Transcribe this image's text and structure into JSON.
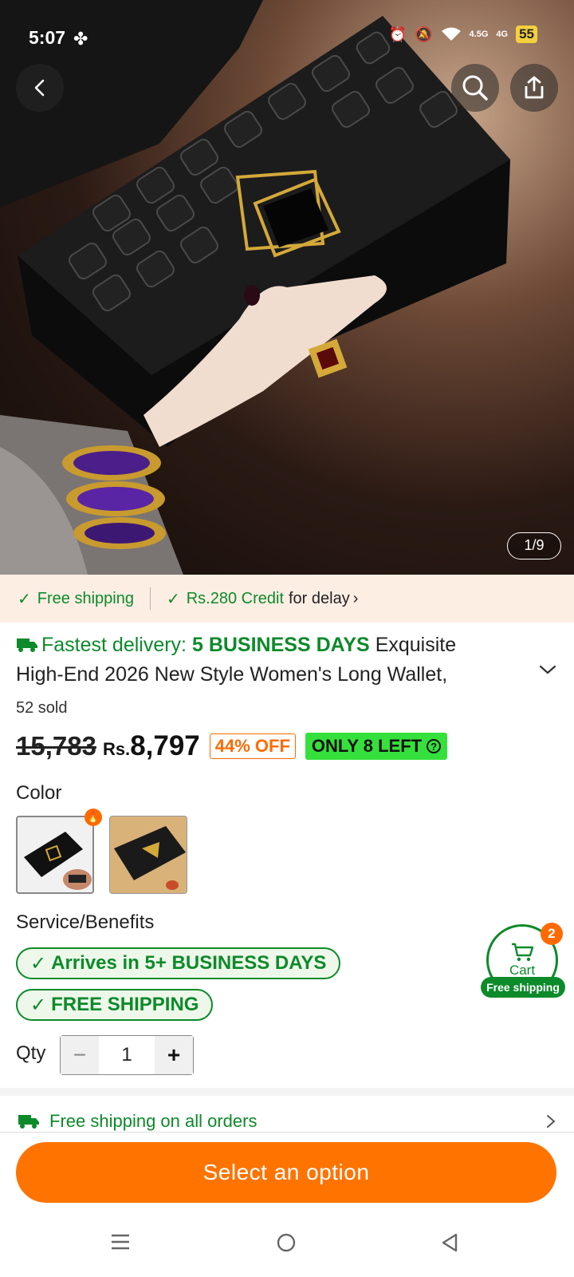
{
  "status_bar": {
    "time": "5:07",
    "battery": "55",
    "net1": "4.5G",
    "net2": "4G"
  },
  "hero": {
    "image_counter": "1/9"
  },
  "benefits_strip": {
    "free_shipping": "Free shipping",
    "credit_amount": "Rs.280 Credit",
    "credit_suffix": "for delay"
  },
  "product": {
    "delivery_prefix": "Fastest delivery:",
    "delivery_days": "5 BUSINESS DAYS",
    "title_line1": "Exquisite",
    "title_line2": "High-End 2026 New Style Women's Long Wallet,",
    "sold": "52 sold",
    "old_price": "15,783",
    "currency": "Rs.",
    "new_price": "8,797",
    "discount": "44% OFF",
    "stock": "ONLY 8 LEFT"
  },
  "color_section": {
    "label": "Color"
  },
  "service": {
    "label": "Service/Benefits",
    "pill1": "Arrives in 5+ BUSINESS DAYS",
    "pill2": "FREE SHIPPING"
  },
  "cart": {
    "label": "Cart",
    "count": "2",
    "free_label": "Free shipping"
  },
  "quantity": {
    "label": "Qty",
    "value": "1"
  },
  "shipping_row": {
    "text": "Free shipping on all orders"
  },
  "cta": {
    "label": "Select an option"
  },
  "colors": {
    "accent_orange": "#ff7300",
    "accent_green": "#0d8a2a",
    "stock_green": "#35e03c"
  }
}
